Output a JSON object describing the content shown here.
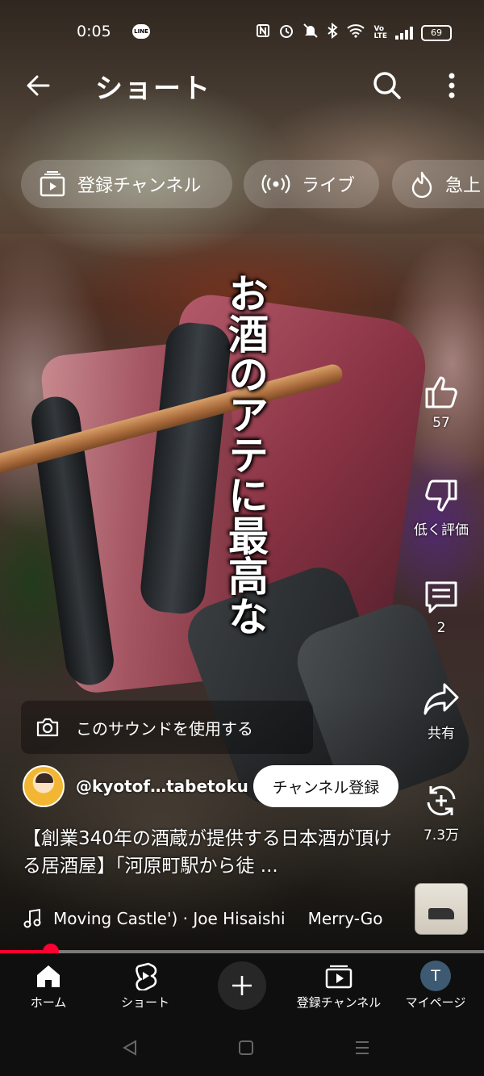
{
  "status_bar": {
    "time": "0:05",
    "line_badge": "LINE",
    "battery": "69"
  },
  "header": {
    "title": "ショート"
  },
  "chips": [
    {
      "label": "登録チャンネル",
      "icon": "subscriptions-icon"
    },
    {
      "label": "ライブ",
      "icon": "live-icon"
    },
    {
      "label": "急上",
      "icon": "trending-icon"
    }
  ],
  "overlay_caption": "お酒のアテに最高な",
  "actions": {
    "like_count": "57",
    "dislike_label": "低く評価",
    "comment_count": "2",
    "share_label": "共有",
    "remix_count": "7.3万"
  },
  "sound": {
    "label": "このサウンドを使用する"
  },
  "channel": {
    "handle": "@kyotof…tabetoku",
    "subscribe_label": "チャンネル登録"
  },
  "video": {
    "title": "【創業340年の酒蔵が提供する日本酒が頂ける居酒屋】「河原町駅から徒 ..."
  },
  "music": {
    "track": "Moving Castle') · Joe Hisaishi",
    "track_next": "Merry-Go"
  },
  "playback": {
    "progress_fraction": 0.105
  },
  "bottom_nav": {
    "home": "ホーム",
    "shorts": "ショート",
    "subscriptions": "登録チャンネル",
    "my_page": "マイページ",
    "avatar_initial": "T"
  }
}
